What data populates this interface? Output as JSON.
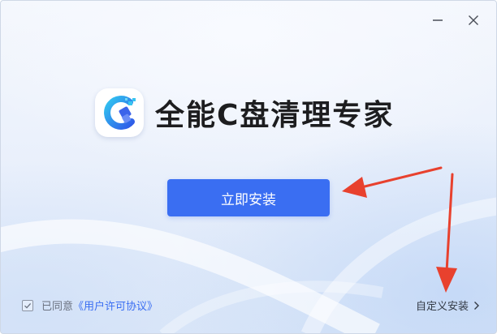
{
  "app": {
    "title": "全能C盘清理专家"
  },
  "actions": {
    "install_label": "立即安装",
    "custom_install_label": "自定义安装"
  },
  "agreement": {
    "prefix": "已同意",
    "link_label": "《用户许可协议》",
    "checked": true
  },
  "icons": {
    "minimize": "minimize-icon",
    "close": "close-icon",
    "checkbox": "checkbox-checked-icon",
    "chevron": "chevron-right-icon",
    "logo": "app-logo-icon"
  },
  "colors": {
    "accent": "#3a6ef2",
    "annotation_arrow": "#e8412e",
    "title_text": "#1d1d1f"
  }
}
